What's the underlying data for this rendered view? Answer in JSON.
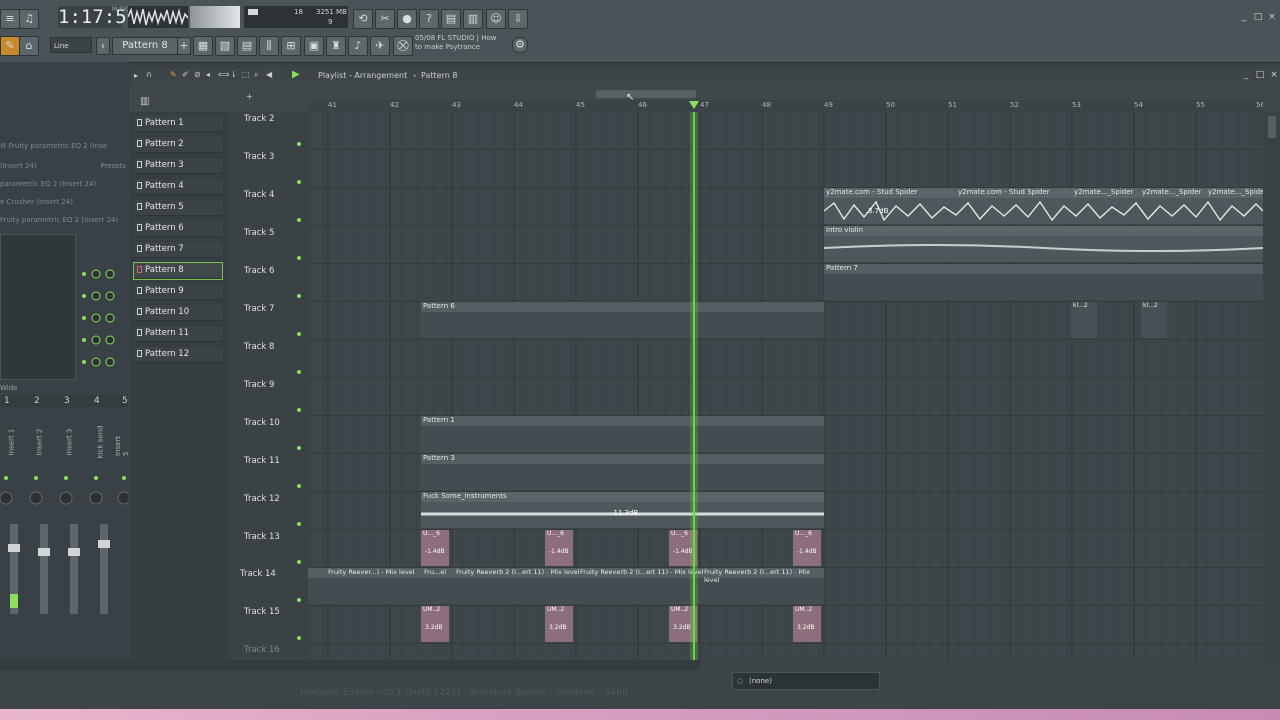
{
  "toolbar": {
    "clock": "1:17:56",
    "clock_units": "M:S:CS",
    "cpu_value": "18",
    "memory": "3251 MB",
    "poly": "9",
    "snap": "Line",
    "current_pattern": "Pattern 8",
    "hint_date": "05/08",
    "hint_title": "FL STUDIO | How",
    "hint_line2": "to make Psytrance"
  },
  "playlist": {
    "title": "Playlist - Arrangement",
    "separator": "›",
    "current_pattern": "Pattern 8"
  },
  "mixer_panel": {
    "fx_rows": [
      {
        "name": "Fruity parametric EQ 2",
        "target": "(Inse"
      },
      {
        "name": "(Insert 24)",
        "target": "Presets"
      },
      {
        "name": "parametric EQ 2",
        "target": "(Insert 24)"
      },
      {
        "name": "e Crusher",
        "target": "(Insert 24)"
      },
      {
        "name": "Fruity parametric EQ 2",
        "target": "(Insert 24)"
      }
    ],
    "inserts": [
      "Insert 1",
      "Insert 2",
      "Insert 3",
      "kick send",
      "Insert 5"
    ],
    "insert_nums": [
      "1",
      "2",
      "3",
      "4",
      "5"
    ],
    "wide_label": "Wide"
  },
  "patterns": [
    "Pattern 1",
    "Pattern 2",
    "Pattern 3",
    "Pattern 4",
    "Pattern 5",
    "Pattern 6",
    "Pattern 7",
    "Pattern 8",
    "Pattern 9",
    "Pattern 10",
    "Pattern 11",
    "Pattern 12"
  ],
  "tracks": [
    "Track 2",
    "Track 3",
    "Track 4",
    "Track 5",
    "Track 6",
    "Track 7",
    "Track 8",
    "Track 9",
    "Track 10",
    "Track 11",
    "Track 12",
    "Track 13",
    "Track 14",
    "Track 15",
    "Track 16"
  ],
  "ruler": [
    "41",
    "42",
    "43",
    "44",
    "45",
    "46",
    "47",
    "48",
    "49",
    "50",
    "51",
    "52",
    "53",
    "54",
    "55",
    "56"
  ],
  "clips": {
    "stud_spider_1": "y2mate.com - Stud Spider",
    "stud_spider_2": "y2mate.com - Stud Spider",
    "stud_spider_3": "y2mate..._Spider",
    "stud_spider_4": "y2mate..._Spider",
    "stud_spider_5": "y2mate..._Spider",
    "gain_37": "3.7dB",
    "intro_violin": "intro violin",
    "pattern7": "Pattern 7",
    "pattern6": "Pattern 6",
    "pattern1": "Pattern 1",
    "pattern3": "Pattern 3",
    "kl2": "kl...2",
    "instruments": "Fuck Some_instruments",
    "gain_113": "-11.3dB",
    "u6": "U..._6",
    "gain_14": "-1.4dB",
    "um2": "UM..2",
    "gain_32": "3.2dB",
    "fx_reverb_a": "Fruity Reever...) - Mix level",
    "fx_reverb_b": "Fru...el",
    "fx_reverb_c": "Fruity Reeverb 2 (I...ert 11) - Mix level",
    "fx_reverb_d": "Fruity Reeverb 2 (I...ert 11) - Mix level",
    "fx_reverb_e": "Fruity Reeverb 2 (I...ert 11) - Mix level"
  },
  "bottom": {
    "none_label": "(none)",
    "status_text": "Producer Edition v20.1 [build 1223] - Signature Bundle - Windows - 64Bit"
  },
  "colors": {
    "playhead": "#6fd63a",
    "clip_audio": "#4d575c",
    "clip_header": "#5a6469",
    "clip_pink": "#8c6e7c",
    "accent_green": "#8ce05a"
  }
}
